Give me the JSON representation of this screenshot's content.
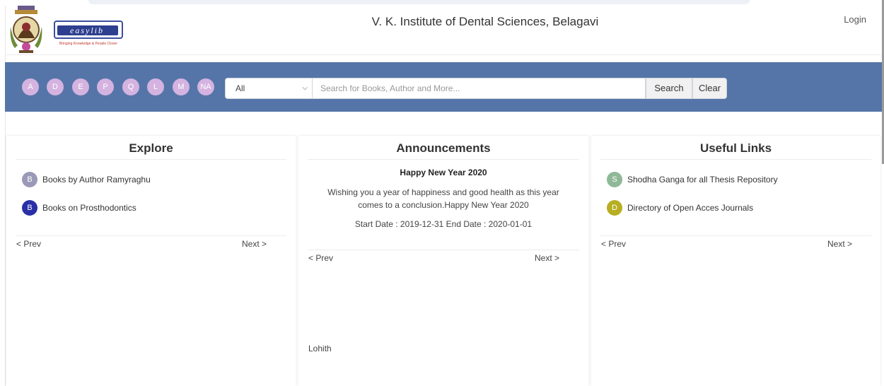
{
  "header": {
    "title": "V. K. Institute of Dental Sciences, Belagavi",
    "login_label": "Login",
    "logo_text": "easylib",
    "logo_tagline": "Bringing Knowledge & People Closer"
  },
  "searchbar": {
    "letters": [
      "A",
      "D",
      "E",
      "P",
      "Q",
      "L",
      "M",
      "NA"
    ],
    "category_selected": "All",
    "search_placeholder": "Search for Books, Author and More...",
    "search_label": "Search",
    "clear_label": "Clear"
  },
  "explore": {
    "title": "Explore",
    "items": [
      {
        "badge": "B",
        "label": "Books by Author Ramyraghu",
        "color": "#9b99b8"
      },
      {
        "badge": "B",
        "label": "Books on Prosthodontics",
        "color": "#2a2fa8"
      }
    ],
    "prev_label": "< Prev",
    "next_label": "Next >"
  },
  "announcements": {
    "title": "Announcements",
    "item_title": "Happy New Year 2020",
    "item_body": "Wishing you a year of happiness and good health as this year comes to a conclusion.Happy New Year 2020",
    "item_dates": "Start Date : 2019-12-31 End Date : 2020-01-01",
    "prev_label": "< Prev",
    "next_label": "Next >",
    "author": "Lohith"
  },
  "useful_links": {
    "title": "Useful Links",
    "items": [
      {
        "badge": "S",
        "label": "Shodha Ganga for all Thesis Repository",
        "color": "#8fb899"
      },
      {
        "badge": "D",
        "label": "Directory of Open Acces Journals",
        "color": "#b7ae22"
      }
    ],
    "prev_label": "< Prev",
    "next_label": "Next >"
  },
  "colors": {
    "search_band": "#5575a8",
    "alpha_button": "#d4b3e0"
  }
}
